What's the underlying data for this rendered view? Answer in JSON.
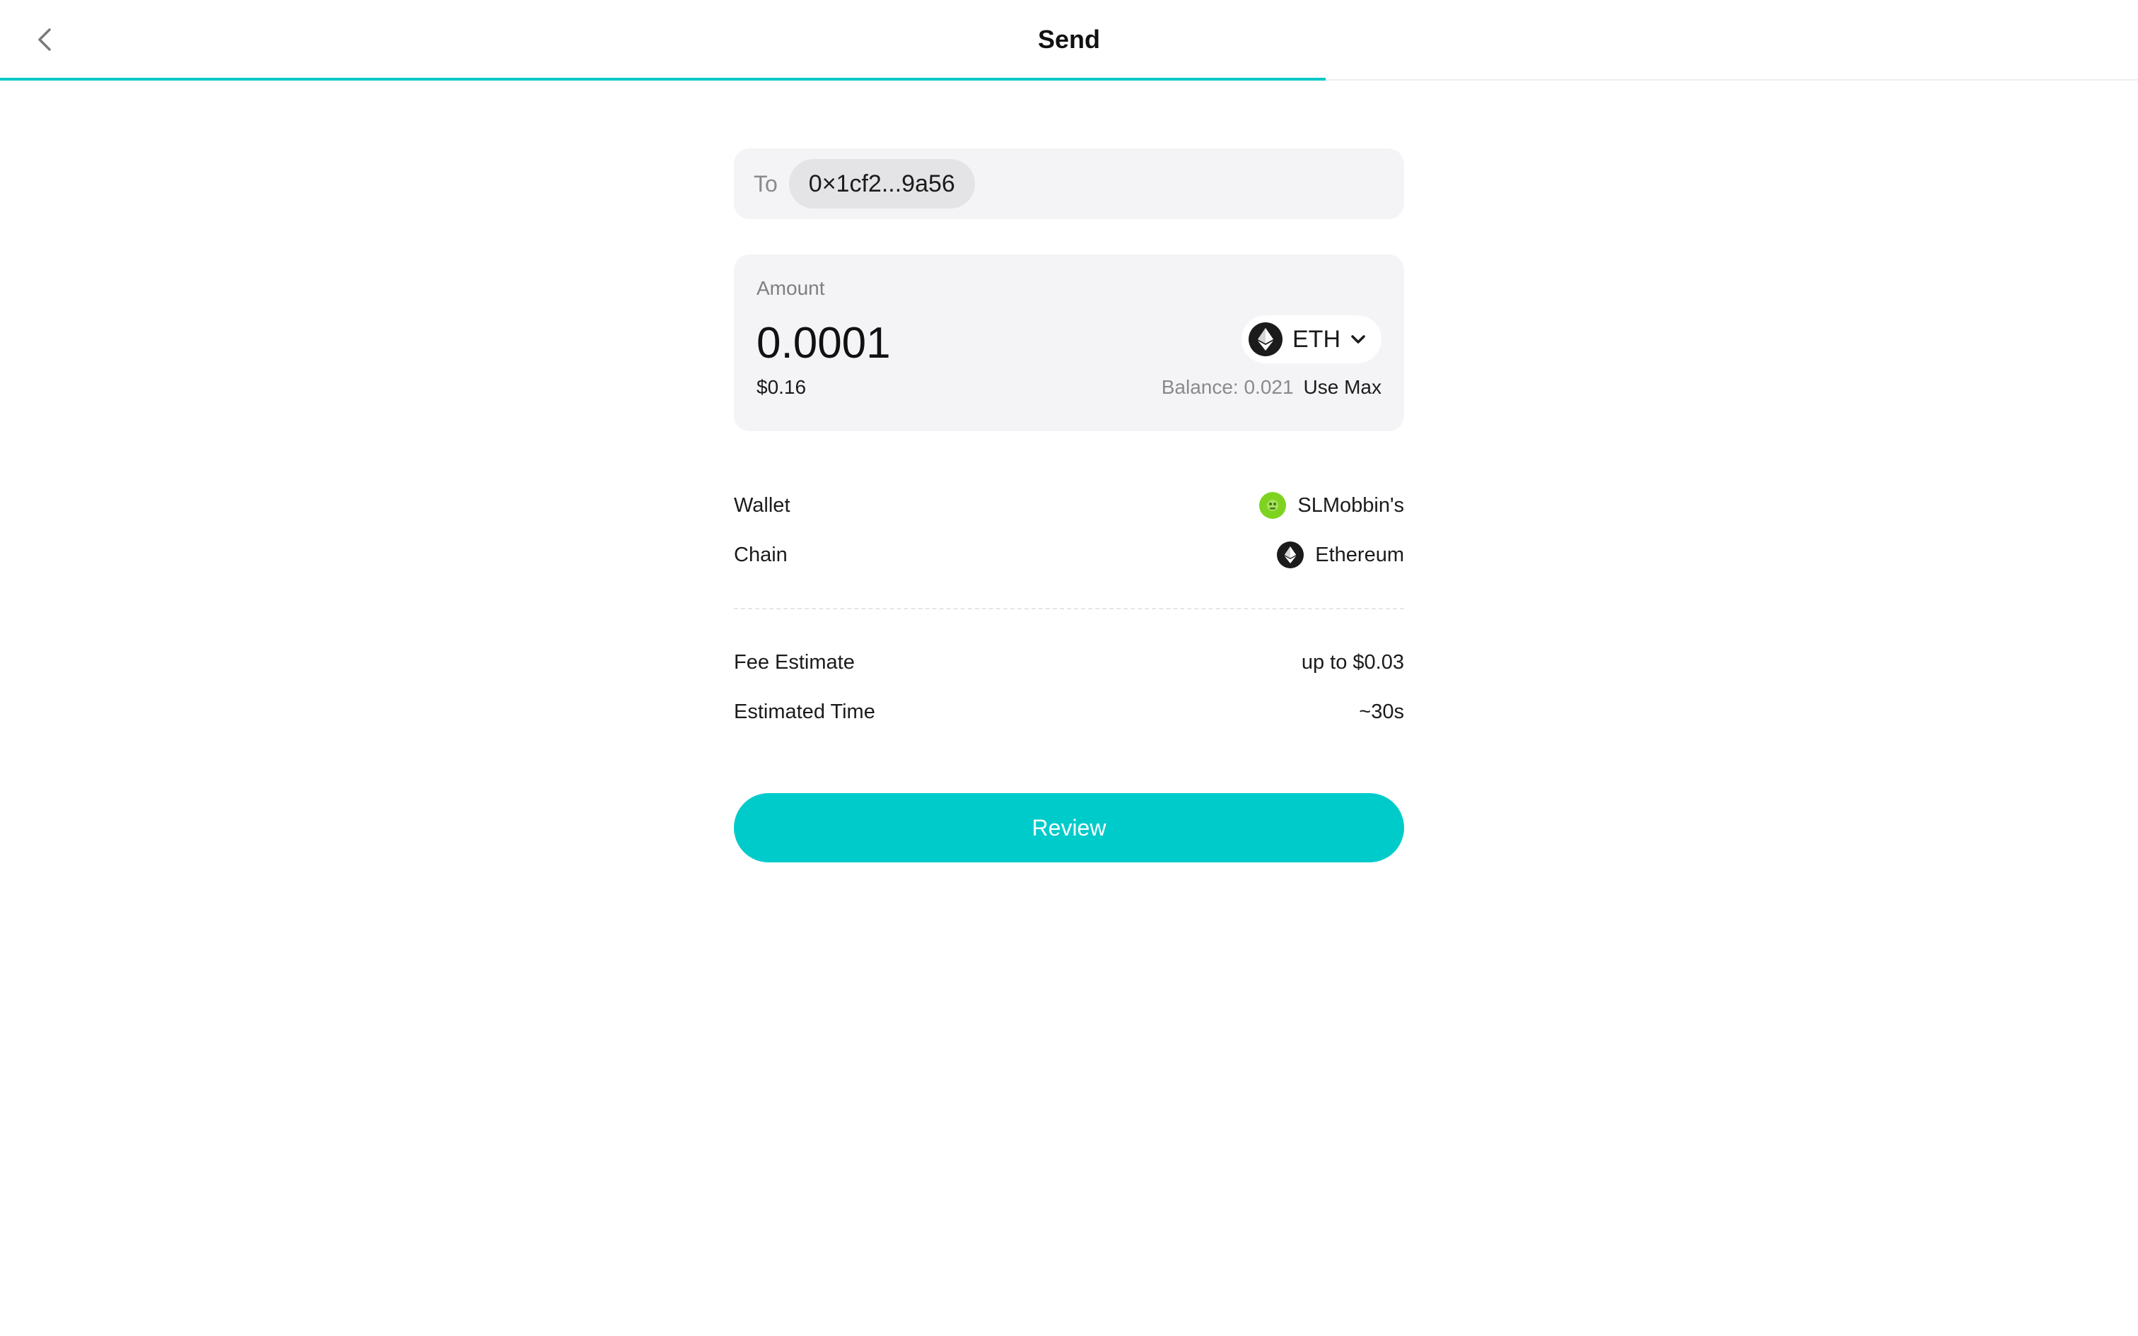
{
  "header": {
    "title": "Send",
    "progress_fraction": 0.62
  },
  "recipient": {
    "label": "To",
    "address": "0×1cf2...9a56"
  },
  "amount": {
    "label": "Amount",
    "value": "0.0001",
    "usd_value": "$0.16",
    "token_symbol": "ETH",
    "token_icon": "ethereum-icon",
    "balance_text": "Balance: 0.021",
    "use_max_label": "Use Max"
  },
  "details": {
    "wallet_label": "Wallet",
    "wallet_name": "SLMobbin's",
    "chain_label": "Chain",
    "chain_name": "Ethereum"
  },
  "fees": {
    "fee_label": "Fee Estimate",
    "fee_value": "up to $0.03",
    "time_label": "Estimated Time",
    "time_value": "~30s"
  },
  "review_label": "Review",
  "colors": {
    "accent": "#00cbcb",
    "panel": "#f4f4f6",
    "wallet_avatar": "#7ed321"
  }
}
